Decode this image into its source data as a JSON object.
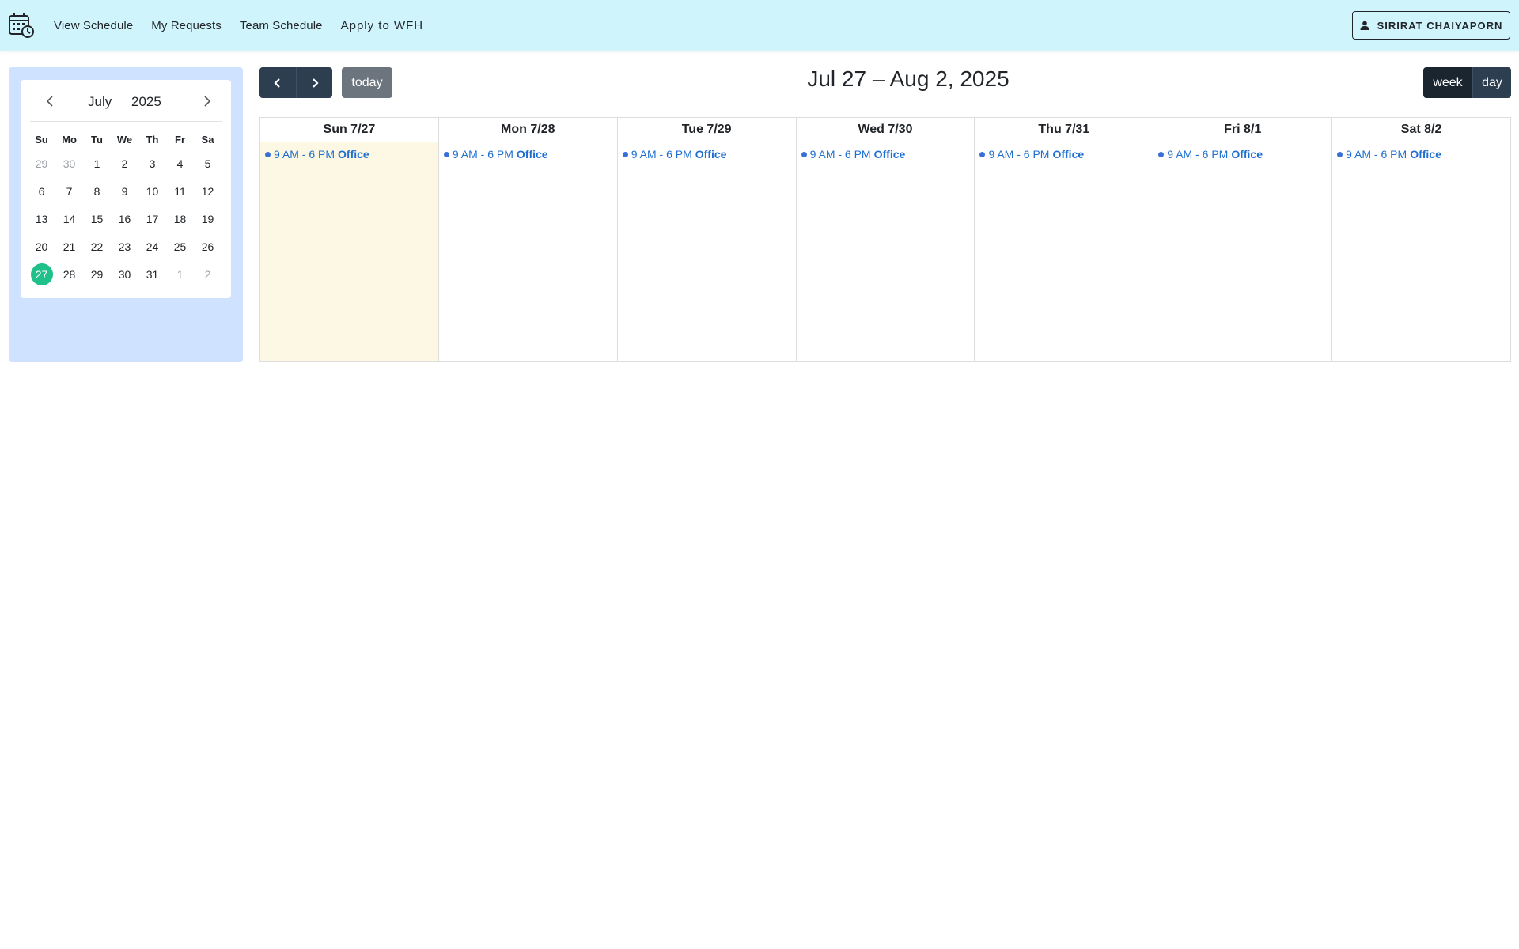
{
  "nav": {
    "links": [
      "View Schedule",
      "My Requests",
      "Team Schedule",
      "Apply to WFH"
    ],
    "user_name": "SIRIRAT CHAIYAPORN"
  },
  "mini_calendar": {
    "month": "July",
    "year": "2025",
    "weekdays": [
      "Su",
      "Mo",
      "Tu",
      "We",
      "Th",
      "Fr",
      "Sa"
    ],
    "weeks": [
      [
        "29",
        "30",
        "1",
        "2",
        "3",
        "4",
        "5"
      ],
      [
        "6",
        "7",
        "8",
        "9",
        "10",
        "11",
        "12"
      ],
      [
        "13",
        "14",
        "15",
        "16",
        "17",
        "18",
        "19"
      ],
      [
        "20",
        "21",
        "22",
        "23",
        "24",
        "25",
        "26"
      ],
      [
        "27",
        "28",
        "29",
        "30",
        "31",
        "1",
        "2"
      ]
    ],
    "selected_day": "27"
  },
  "toolbar": {
    "today_label": "today",
    "title": "Jul 27 – Aug 2, 2025",
    "views": [
      "week",
      "day"
    ],
    "active_view": "week"
  },
  "week": {
    "days": [
      {
        "label": "Sun 7/27",
        "event_time": "9 AM - 6 PM",
        "event_title": "Office",
        "is_today": true
      },
      {
        "label": "Mon 7/28",
        "event_time": "9 AM - 6 PM",
        "event_title": "Office"
      },
      {
        "label": "Tue 7/29",
        "event_time": "9 AM - 6 PM",
        "event_title": "Office"
      },
      {
        "label": "Wed 7/30",
        "event_time": "9 AM - 6 PM",
        "event_title": "Office"
      },
      {
        "label": "Thu 7/31",
        "event_time": "9 AM - 6 PM",
        "event_title": "Office"
      },
      {
        "label": "Fri 8/1",
        "event_time": "9 AM - 6 PM",
        "event_title": "Office"
      },
      {
        "label": "Sat 8/2",
        "event_time": "9 AM - 6 PM",
        "event_title": "Office"
      }
    ]
  },
  "colors": {
    "topbar_bg": "#cff4fc",
    "sidebar_bg": "#cfe2ff",
    "selected_day": "#20c08a",
    "today_column": "#fcf8e3",
    "event_text": "#1f6fd1",
    "primary_dark": "#2c3e50"
  },
  "icons": {
    "logo": "calendar-clock-icon",
    "user": "person-icon",
    "prev": "chevron-left-icon",
    "next": "chevron-right-icon"
  }
}
